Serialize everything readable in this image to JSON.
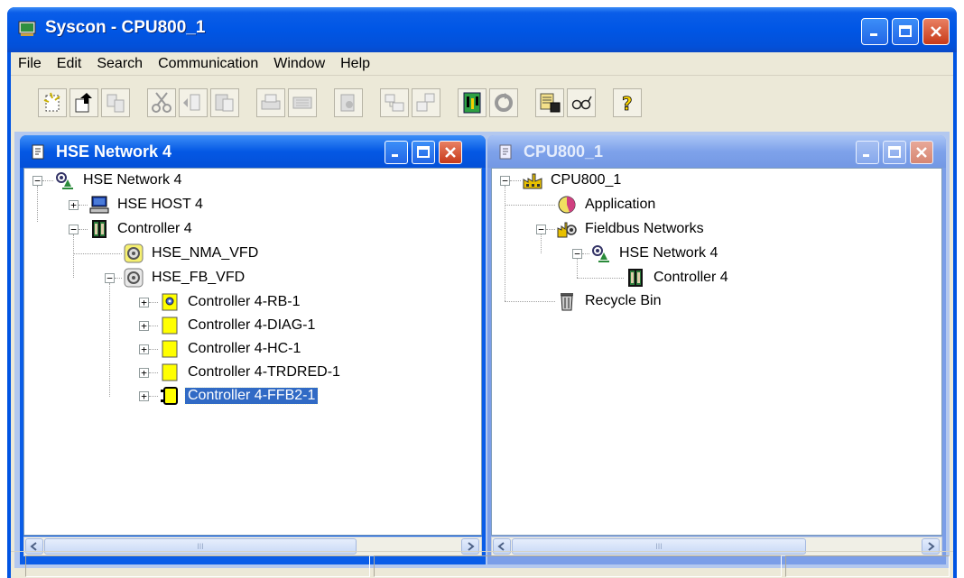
{
  "window": {
    "title": "Syscon - CPU800_1"
  },
  "menu": [
    "File",
    "Edit",
    "Search",
    "Communication",
    "Window",
    "Help"
  ],
  "toolbar": {
    "buttons": [
      "new-icon",
      "open-icon",
      "save-icon",
      "cut-icon",
      "copy-icon",
      "paste-icon",
      "print-icon",
      "preview-icon",
      "properties-icon",
      "expand-icon",
      "collapse-icon",
      "network-icon",
      "refresh-icon",
      "download-icon",
      "watch-icon",
      "help-icon"
    ]
  },
  "left_panel": {
    "title": "HSE Network 4",
    "tree": [
      {
        "label": "HSE Network 4",
        "icon": "network-icon",
        "level": 0,
        "state": "expanded"
      },
      {
        "label": "HSE HOST 4",
        "icon": "computer-icon",
        "level": 1,
        "state": "collapsed"
      },
      {
        "label": "Controller 4",
        "icon": "controller-icon",
        "level": 1,
        "state": "expanded"
      },
      {
        "label": "HSE_NMA_VFD",
        "icon": "vfd-icon",
        "level": 2,
        "state": "leaf"
      },
      {
        "label": "HSE_FB_VFD",
        "icon": "vfd-icon",
        "level": 2,
        "state": "expanded"
      },
      {
        "label": "Controller 4-RB-1",
        "icon": "resource-block-icon",
        "level": 3,
        "state": "collapsed"
      },
      {
        "label": "Controller 4-DIAG-1",
        "icon": "function-block-icon",
        "level": 3,
        "state": "collapsed"
      },
      {
        "label": "Controller 4-HC-1",
        "icon": "function-block-icon",
        "level": 3,
        "state": "collapsed"
      },
      {
        "label": "Controller 4-TRDRED-1",
        "icon": "function-block-icon",
        "level": 3,
        "state": "collapsed"
      },
      {
        "label": "Controller 4-FFB2-1",
        "icon": "flexible-block-icon",
        "level": 3,
        "state": "collapsed",
        "selected": true
      }
    ]
  },
  "right_panel": {
    "title": "CPU800_1",
    "tree": [
      {
        "label": "CPU800_1",
        "icon": "plant-icon",
        "level": 0,
        "state": "expanded"
      },
      {
        "label": "Application",
        "icon": "application-icon",
        "level": 1,
        "state": "leaf"
      },
      {
        "label": "Fieldbus Networks",
        "icon": "fieldbus-icon",
        "level": 1,
        "state": "expanded"
      },
      {
        "label": "HSE Network 4",
        "icon": "network-icon",
        "level": 2,
        "state": "expanded"
      },
      {
        "label": "Controller 4",
        "icon": "controller-icon",
        "level": 3,
        "state": "leaf"
      },
      {
        "label": "Recycle Bin",
        "icon": "recycle-bin-icon",
        "level": 1,
        "state": "leaf"
      }
    ]
  },
  "scroll_thumb_grip": "III",
  "colors": {
    "titlebar": "#0054e3",
    "selection": "#316ac5",
    "mdi_background": "#b3c8ef",
    "function_block": "#ffff00"
  }
}
